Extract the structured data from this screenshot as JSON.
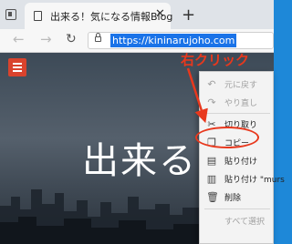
{
  "tab": {
    "title": "出来る！気になる情報Blog"
  },
  "address": {
    "url": "https://kininarujoho.com"
  },
  "page": {
    "hero_text": "出来る"
  },
  "menu": {
    "items": [
      {
        "label": "元に戻す",
        "icon": "undo-icon",
        "enabled": false
      },
      {
        "label": "やり直し",
        "icon": "redo-icon",
        "enabled": false
      },
      {
        "label": "切り取り",
        "icon": "scissors-icon",
        "enabled": true
      },
      {
        "label": "コピー",
        "icon": "copy-icon",
        "enabled": true
      },
      {
        "label": "貼り付け",
        "icon": "paste-icon",
        "enabled": true
      },
      {
        "label": "貼り付け \"murs",
        "icon": "paste-text-icon",
        "enabled": true
      },
      {
        "label": "削除",
        "icon": "trash-icon",
        "enabled": true
      },
      {
        "label": "すべて選択",
        "icon": "",
        "enabled": false
      }
    ]
  },
  "annotation": {
    "callout": "右クリック",
    "color": "#e8381d"
  },
  "colors": {
    "desktop": "#1e88d8",
    "selection": "#1a73e8",
    "hamburger": "#d9432d"
  }
}
